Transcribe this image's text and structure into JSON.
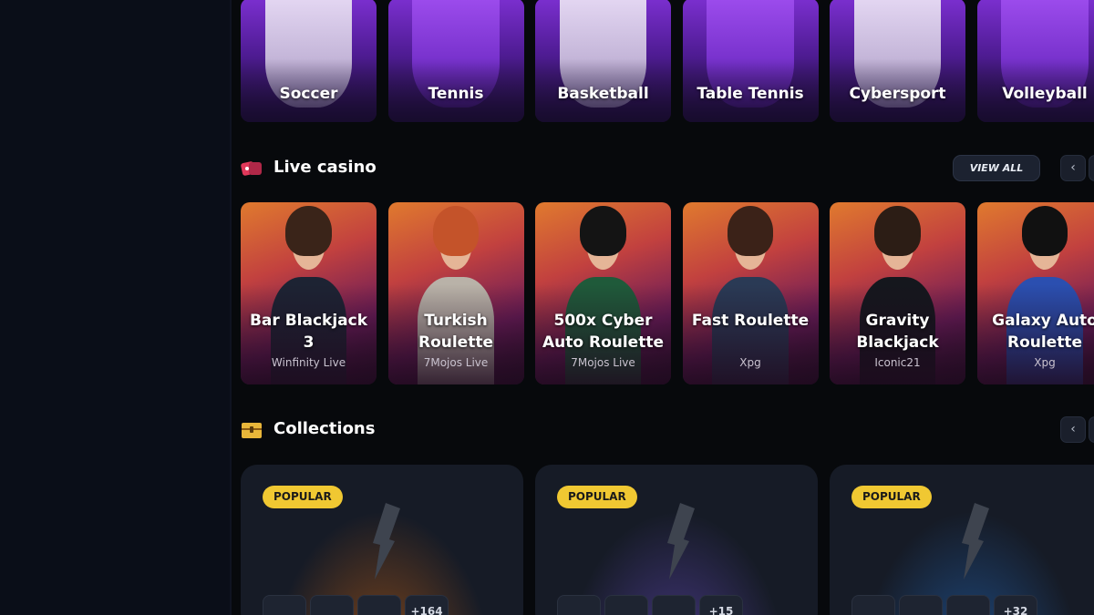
{
  "sports": [
    {
      "label": "Soccer",
      "style": "white"
    },
    {
      "label": "Tennis",
      "style": "purple"
    },
    {
      "label": "Basketball",
      "style": "white"
    },
    {
      "label": "Table Tennis",
      "style": "purple"
    },
    {
      "label": "Cybersport",
      "style": "white"
    },
    {
      "label": "Volleyball",
      "style": "purple"
    }
  ],
  "live_casino": {
    "title": "Live casino",
    "view_all_label": "VIEW ALL",
    "prev_icon": "chevron-left-icon",
    "next_icon": "chevron-right-icon",
    "games": [
      {
        "name": "Bar Blackjack 3",
        "provider": "Winfinity Live",
        "hair": "#3a2419",
        "outfit": "#1d2333"
      },
      {
        "name": "Turkish Roulette",
        "provider": "7Mojos Live",
        "hair": "#c4532a",
        "outfit": "#b9b2a8"
      },
      {
        "name": "500x Cyber Auto Roulette",
        "provider": "7Mojos Live",
        "hair": "#141414",
        "outfit": "#1f5a3a"
      },
      {
        "name": "Fast Roulette",
        "provider": "Xpg",
        "hair": "#3b2218",
        "outfit": "#2a3a55"
      },
      {
        "name": "Gravity Blackjack",
        "provider": "Iconic21",
        "hair": "#2c1d15",
        "outfit": "#15171d"
      },
      {
        "name": "Galaxy Auto Roulette",
        "provider": "Xpg",
        "hair": "#111111",
        "outfit": "#2b4fb0"
      }
    ]
  },
  "collections": {
    "title": "Collections",
    "prev_icon": "chevron-left-icon",
    "next_icon": "chevron-right-icon",
    "cards": [
      {
        "badge": "POPULAR",
        "more": "+164",
        "glow": "#8a4a1a"
      },
      {
        "badge": "POPULAR",
        "more": "+15",
        "glow": "#4a3a8a"
      },
      {
        "badge": "POPULAR",
        "more": "+32",
        "glow": "#1f4f8a"
      }
    ]
  },
  "colors": {
    "accent_yellow": "#f0c832",
    "live_casino_icon": "#e0385a",
    "collections_icon": "#e8b63a"
  }
}
